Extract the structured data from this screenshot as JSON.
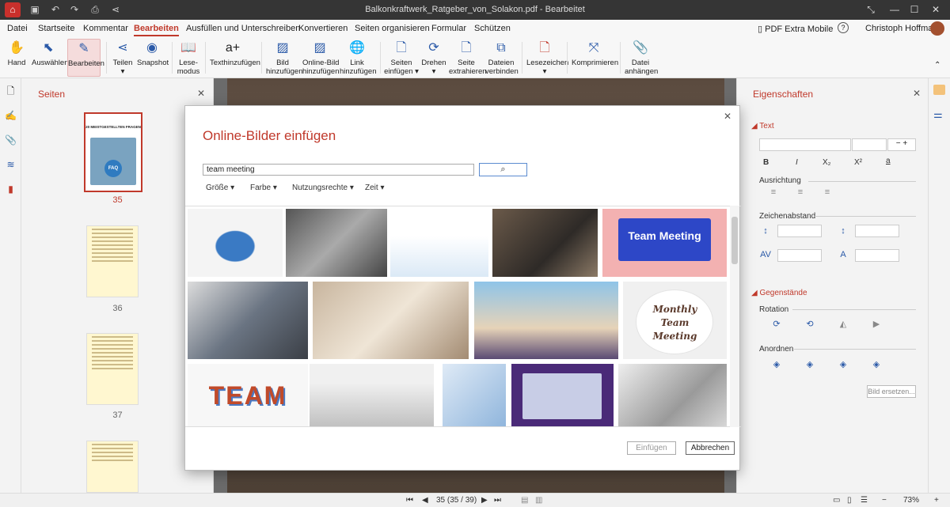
{
  "titlebar": {
    "title": "Balkonkraftwerk_Ratgeber_von_Solakon.pdf - Bearbeitet"
  },
  "menu": [
    "Datei",
    "Startseite",
    "Kommentar",
    "Bearbeiten",
    "Ausfüllen und Unterschreiben",
    "Konvertieren",
    "Seiten organisieren",
    "Formular",
    "Schützen"
  ],
  "menu_right": {
    "mobile": "PDF Extra Mobile",
    "help": "?",
    "user": "Christoph Hoffmann"
  },
  "ribbon": [
    "Hand",
    "Auswählen",
    "Bearbeiten",
    "Teilen",
    "Snapshot",
    "Lese-\nmodus",
    "Texthinzufügen",
    "Bild\nhinzufügen",
    "Online-Bild\nhinzufügen",
    "Link\nhinzufügen",
    "Seiten\neinfügen",
    "Drehen",
    "Seite\nextrahieren",
    "Dateien\nverbinden",
    "Lesezeichen",
    "Komprimieren",
    "Datei\nanhängen"
  ],
  "pages": {
    "title": "Seiten",
    "thumb1": "20 MEISTGESTELLTEN FRAGEN",
    "thumb_faq": "FAQ",
    "nums": [
      "35",
      "36",
      "37"
    ]
  },
  "properties": {
    "title": "Eigenschaften",
    "text": "Text",
    "bold": "B",
    "italic": "I",
    "sub": "X₂",
    "sup": "X²",
    "color": "a",
    "alignment": "Ausrichtung",
    "spacing": "Zeichenabstand",
    "objects": "Gegenstände",
    "rotation": "Rotation",
    "arrange": "Anordnen",
    "replace": "Bild ersetzen..."
  },
  "dialog": {
    "title": "Online-Bilder einfügen",
    "search_value": "team meeting",
    "filters": [
      "Größe",
      "Farbe",
      "Nutzungsrechte",
      "Zeit"
    ],
    "insert": "Einfügen",
    "cancel": "Abbrechen"
  },
  "tiles": {
    "t5": "Team Meeting",
    "t9a": "Monthly",
    "t9b": "Team",
    "t9c": "Meeting",
    "t10": "TEAM"
  },
  "status": {
    "page": "35 (35 / 39)",
    "zoom": "73%"
  }
}
